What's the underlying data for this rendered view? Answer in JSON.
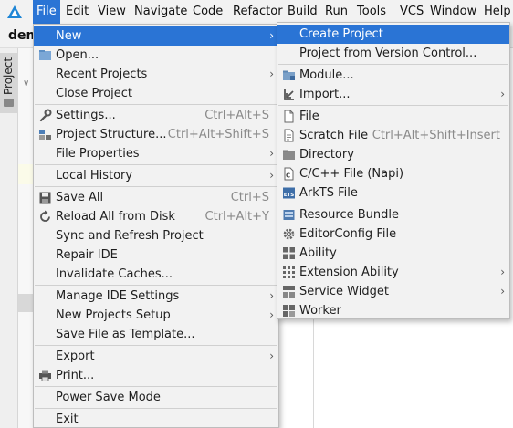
{
  "menubar": {
    "items": [
      {
        "label": "File",
        "mnemonic": "F",
        "active": true
      },
      {
        "label": "Edit",
        "mnemonic": "E"
      },
      {
        "label": "View",
        "mnemonic": "V"
      },
      {
        "label": "Navigate",
        "mnemonic": "N"
      },
      {
        "label": "Code",
        "mnemonic": "C"
      },
      {
        "label": "Refactor",
        "mnemonic": "R"
      },
      {
        "label": "Build",
        "mnemonic": "B"
      },
      {
        "label": "Run",
        "mnemonic": "u"
      },
      {
        "label": "Tools",
        "mnemonic": "T"
      },
      {
        "label": "VCS",
        "mnemonic": "S"
      },
      {
        "label": "Window",
        "mnemonic": "W"
      },
      {
        "label": "Help",
        "mnemonic": "H"
      }
    ]
  },
  "ide": {
    "project_name": "dem",
    "side_tab_label": "Project"
  },
  "file_menu": {
    "items": [
      {
        "label": "New",
        "submenu": true,
        "highlighted": true
      },
      {
        "label": "Open...",
        "icon": "folder-open-icon"
      },
      {
        "label": "Recent Projects",
        "submenu": true
      },
      {
        "label": "Close Project"
      },
      {
        "separator": true
      },
      {
        "label": "Settings...",
        "icon": "wrench-icon",
        "shortcut": "Ctrl+Alt+S"
      },
      {
        "label": "Project Structure...",
        "icon": "project-structure-icon",
        "shortcut": "Ctrl+Alt+Shift+S"
      },
      {
        "label": "File Properties",
        "submenu": true
      },
      {
        "separator": true
      },
      {
        "label": "Local History",
        "submenu": true
      },
      {
        "separator": true
      },
      {
        "label": "Save All",
        "icon": "save-icon",
        "shortcut": "Ctrl+S"
      },
      {
        "label": "Reload All from Disk",
        "icon": "reload-icon",
        "shortcut": "Ctrl+Alt+Y"
      },
      {
        "label": "Sync and Refresh Project"
      },
      {
        "label": "Repair IDE"
      },
      {
        "label": "Invalidate Caches..."
      },
      {
        "separator": true
      },
      {
        "label": "Manage IDE Settings",
        "submenu": true
      },
      {
        "label": "New Projects Setup",
        "submenu": true
      },
      {
        "label": "Save File as Template..."
      },
      {
        "separator": true
      },
      {
        "label": "Export",
        "submenu": true
      },
      {
        "label": "Print...",
        "icon": "print-icon"
      },
      {
        "separator": true
      },
      {
        "label": "Power Save Mode"
      },
      {
        "separator": true
      },
      {
        "label": "Exit"
      }
    ]
  },
  "new_menu": {
    "items": [
      {
        "label": "Create Project",
        "highlighted": true
      },
      {
        "label": "Project from Version Control..."
      },
      {
        "separator": true
      },
      {
        "label": "Module...",
        "icon": "module-icon"
      },
      {
        "label": "Import...",
        "icon": "import-icon",
        "submenu": true
      },
      {
        "separator": true
      },
      {
        "label": "File",
        "icon": "file-icon"
      },
      {
        "label": "Scratch File",
        "icon": "scratch-file-icon",
        "shortcut": "Ctrl+Alt+Shift+Insert"
      },
      {
        "label": "Directory",
        "icon": "folder-icon"
      },
      {
        "label": "C/C++ File (Napi)",
        "icon": "cpp-file-icon"
      },
      {
        "label": "ArkTS File",
        "icon": "arkts-file-icon"
      },
      {
        "separator": true
      },
      {
        "label": "Resource Bundle",
        "icon": "resource-bundle-icon"
      },
      {
        "label": "EditorConfig File",
        "icon": "gear-icon"
      },
      {
        "label": "Ability",
        "icon": "ability-icon"
      },
      {
        "label": "Extension Ability",
        "icon": "extension-ability-icon",
        "submenu": true
      },
      {
        "label": "Service Widget",
        "icon": "service-widget-icon",
        "submenu": true
      },
      {
        "label": "Worker",
        "icon": "worker-icon"
      }
    ]
  },
  "colors": {
    "highlight": "#2a74d5",
    "menu_bg": "#f2f2f2",
    "shortcut": "#8a8a8a"
  }
}
